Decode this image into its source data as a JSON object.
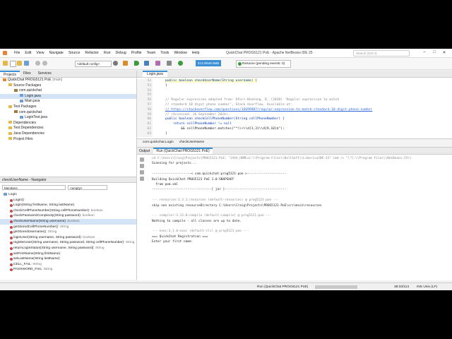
{
  "window": {
    "title": "QuickChat PROG5121 PoE - Apache NetBeans IDE 25",
    "menu": [
      "File",
      "Edit",
      "View",
      "Navigate",
      "Source",
      "Refactor",
      "Run",
      "Debug",
      "Profile",
      "Team",
      "Tools",
      "Window",
      "Help"
    ],
    "search_placeholder": "Search (Ctrl+I)"
  },
  "toolbar": {
    "config": "<default config>",
    "memory": "313.0/548.0MB",
    "resume": "Resume (pending events: 0)"
  },
  "left_tabs": [
    "Projects",
    "Files",
    "Services"
  ],
  "project_tree": [
    {
      "label": "QuickChat PROG5121 PoE",
      "suffix": "[main]",
      "icon": "project"
    },
    {
      "label": "Source Packages",
      "icon": "folder"
    },
    {
      "label": "com.quickchat",
      "icon": "package"
    },
    {
      "label": "Login.java",
      "icon": "java",
      "selected": true
    },
    {
      "label": "Main.java",
      "icon": "java"
    },
    {
      "label": "Test Packages",
      "icon": "folder"
    },
    {
      "label": "com.quickchat",
      "icon": "package"
    },
    {
      "label": "LoginTest.java",
      "icon": "java"
    },
    {
      "label": "Dependencies",
      "icon": "folder"
    },
    {
      "label": "Test Dependencies",
      "icon": "folder"
    },
    {
      "label": "Java Dependencies",
      "icon": "folder"
    },
    {
      "label": "Project Files",
      "icon": "folder"
    }
  ],
  "navigator": {
    "title": "checkUserName - Navigator",
    "members_label": "Members",
    "filter_label": "<empty>",
    "root": "Login",
    "items": [
      {
        "name": "Login()",
        "ret": ""
      },
      {
        "name": "Login(String firstName, String lastName)",
        "ret": ""
      },
      {
        "name": "checkCellPhoneNumber(String cellPhoneNumber)",
        "ret": ": boolean"
      },
      {
        "name": "checkPasswordComplexity(String password)",
        "ret": ": boolean"
      },
      {
        "name": "checkUserName(String username)",
        "ret": ": boolean",
        "selected": true
      },
      {
        "name": "getStoredCellPhoneNumber()",
        "ret": ": String"
      },
      {
        "name": "getStoredUsername()",
        "ret": ": String"
      },
      {
        "name": "loginUser(String username, String password)",
        "ret": ": boolean"
      },
      {
        "name": "registerUser(String username, String password, String cellPhoneNumber)",
        "ret": ": String"
      },
      {
        "name": "returnLoginStatus(String username, String password)",
        "ret": ": String"
      },
      {
        "name": "setFirstName(String firstName)",
        "ret": ""
      },
      {
        "name": "setLastName(String lastName)",
        "ret": ""
      },
      {
        "name": "CELL_FAIL",
        "ret": ": String"
      },
      {
        "name": "PASSWORD_FAIL",
        "ret": ": String"
      }
    ]
  },
  "editor": {
    "tab": "Login.java",
    "lines": [
      {
        "n": "52",
        "text": "public boolean checkUserName(String username) {"
      },
      {
        "n": "53",
        "text": "}"
      },
      {
        "n": "54",
        "text": ""
      },
      {
        "n": "55",
        "text": ""
      },
      {
        "n": "56",
        "text": "// Regular expression adapted from: Ofori-Boateng, D. (2020) 'Regular expression to match"
      },
      {
        "n": "57",
        "text": "// standard 10 digit phone number', Stack Overflow. Available at:"
      },
      {
        "n": "58",
        "text": "// https://stackoverflow.com/questions/16699007/regular-expression-to-match-standard-10-digit-phone-number"
      },
      {
        "n": "59",
        "text": "// (Accessed: 16 September 2024)."
      },
      {
        "n": "60",
        "text": "public boolean checkCellPhoneNumber(String cellPhoneNumber) {"
      },
      {
        "n": "61",
        "text": "    return cellPhoneNumber != null"
      },
      {
        "n": "62",
        "text": "        && cellPhoneNumber.matches(\"^\\\\+\\\\d{1,3}\\\\d{9,10}$\");"
      },
      {
        "n": "63",
        "text": "}"
      }
    ],
    "breadcrumbs": [
      "com.quickchat.Login",
      "checkUserName"
    ]
  },
  "output": {
    "tab_prefix": "Output",
    "tab": "Run (QuickChat PROG5121 PoE)",
    "lines": [
      "cd C:\\Users\\Craig\\Projects\\PROG5121-PoE; \"JAVA_HOME=C:\\\\Program Files\\\\BellSoft\\\\LibericaJDK-23\" cmd /c \"\\\"C:\\\\Program Files\\\\NetBeans-25\\\\",
      "Scanning for projects...",
      "",
      "---------------------< com.quickchat:prog5121-poe >---------------------",
      "Building QuickChat PROG5121 PoE 1.0-SNAPSHOT",
      "  from pom.xml",
      "--------------------------------[ jar ]---------------------------------",
      "",
      "--- resources:3.3.1:resources (default-resources) @ prog5121-poe ---",
      "skip non existing resourceDirectory C:\\Users\\Craig\\Projects\\PROG5121-PoE\\src\\main\\resources",
      "",
      "--- compiler:3.13.0:compile (default-compile) @ prog5121-poe ---",
      "Nothing to compile - all classes are up to date.",
      "",
      "--- exec:3.1.0:exec (default-cli) @ prog5121-poe ---",
      "=== QuickChat Registration ===",
      "Enter your first name:"
    ]
  },
  "status": {
    "run": "Run (QuickChat PROG5121 PoE)",
    "position": "38:33/113",
    "mode": "INS  Unix (LF)"
  },
  "colors": {
    "accent": "#3a8fd6",
    "selection": "#d4e3f6"
  }
}
